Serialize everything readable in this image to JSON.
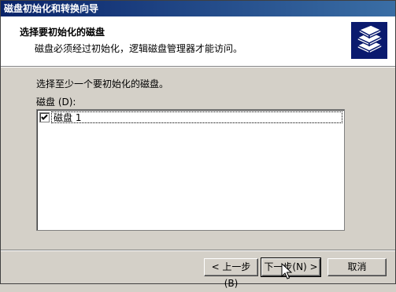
{
  "window": {
    "title": "磁盘初始化和转换向导"
  },
  "header": {
    "title": "选择要初始化的磁盘",
    "subtitle": "磁盘必须经过初始化，逻辑磁盘管理器才能访问。",
    "icon": "disk-stack-icon"
  },
  "body": {
    "instruction": "选择至少一个要初始化的磁盘。",
    "disk_list_label": "磁盘 (D):",
    "disks": [
      {
        "label": "磁盘 1",
        "checked": true
      }
    ]
  },
  "buttons": {
    "back": "< 上一步(B)",
    "next": "下一步(N) >",
    "cancel": "取消"
  }
}
